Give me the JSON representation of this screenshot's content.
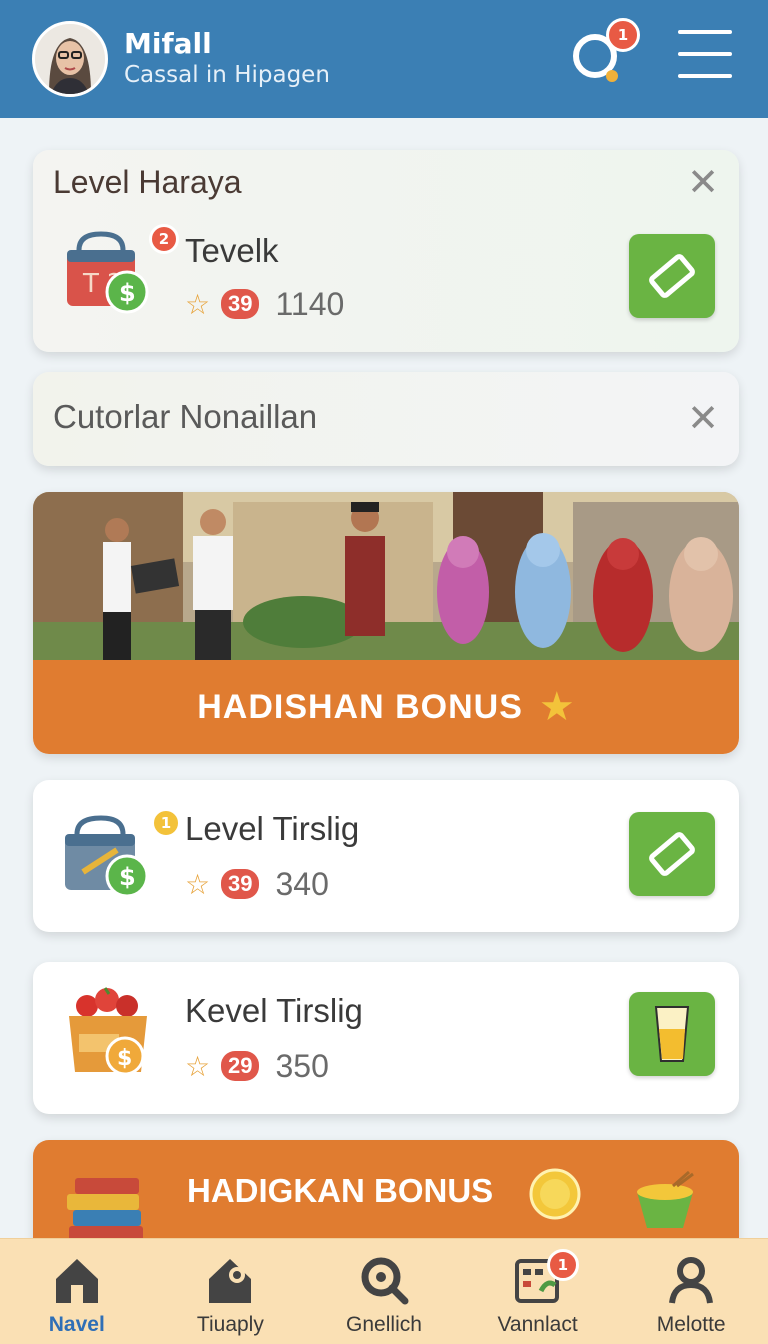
{
  "header": {
    "name": "Mifall",
    "subtitle": "Cassal in Hipagen",
    "notification_count": "1"
  },
  "cards": [
    {
      "title": "Level Haraya",
      "item_title": "Tevelk",
      "item_badge": "2",
      "pill": "39",
      "value": "1140"
    },
    {
      "title": "Cutorlar Nonaillan"
    },
    {
      "banner_label": "HADISHAN BONUS"
    },
    {
      "item_title": "Level Tirslig",
      "item_badge": "1",
      "pill": "39",
      "value": "340"
    },
    {
      "item_title": "Kevel Tirslig",
      "pill": "29",
      "value": "350"
    },
    {
      "banner_label": "HADIGKAN BONUS"
    }
  ],
  "nav": [
    {
      "label": "Navel",
      "icon": "home-icon"
    },
    {
      "label": "Tiuaply",
      "icon": "house-settings-icon"
    },
    {
      "label": "Gnellich",
      "icon": "search-icon"
    },
    {
      "label": "Vannlact",
      "icon": "calendar-icon",
      "badge": "1"
    },
    {
      "label": "Melotte",
      "icon": "profile-icon"
    }
  ],
  "colors": {
    "header": "#3b7fb4",
    "accent_green": "#6ab443",
    "accent_orange": "#e07c30",
    "pill_red": "#e0574a",
    "nav_bg": "#fae0b4",
    "nav_active": "#2f6fb6"
  }
}
